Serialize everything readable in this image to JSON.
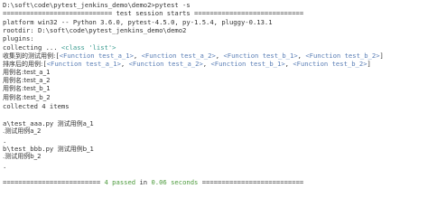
{
  "colors": {
    "background": "#ffffff",
    "text": "#333333",
    "function_repr": "#5b7fb6",
    "class_repr": "#3a9b8f",
    "passed": "#4c9a3c"
  },
  "console": {
    "command_line": "D:\\soft\\code\\pytest_jenkins_demo\\demo2>pytest -s",
    "session_header": "============================ test session starts ============================",
    "platform": "platform win32 -- Python 3.6.0, pytest-4.5.0, py-1.5.4, pluggy-0.13.1",
    "rootdir": "rootdir: D:\\soft\\code\\pytest_jenkins_demo\\demo2",
    "plugins": "plugins:",
    "collecting_prefix": "collecting ... ",
    "collecting_class": "<class 'list'>",
    "collected_label": "收集到的测试用例:",
    "collected_items": [
      "<Function test_a_1>",
      "<Function test_a_2>",
      "<Function test_b_1>",
      "<Function test_b_2>"
    ],
    "sorted_label": "排序后的用例:",
    "sorted_items": [
      "<Function test_a_1>",
      "<Function test_a_2>",
      "<Function test_b_1>",
      "<Function test_b_2>"
    ],
    "case_names": [
      "用例名:test_a_1",
      "用例名:test_a_2",
      "用例名:test_b_1",
      "用例名:test_b_2"
    ],
    "collected_summary": "collected 4 items",
    "file_a": "a\\test_aaa.py",
    "file_a_case_1": "测试用例a_1",
    "file_a_case_2": ".测试用例a_2",
    "dot_after_a": ".",
    "file_b": "b\\test_bbb.py",
    "file_b_case_1": "测试用例b_1",
    "file_b_case_2": ".测试用例b_2",
    "dot_after_b": ".",
    "summary_left": "========================= ",
    "summary_passed": "4 passed",
    "summary_in": " in ",
    "summary_time": "0.06 seconds",
    "summary_right": " =========================="
  }
}
